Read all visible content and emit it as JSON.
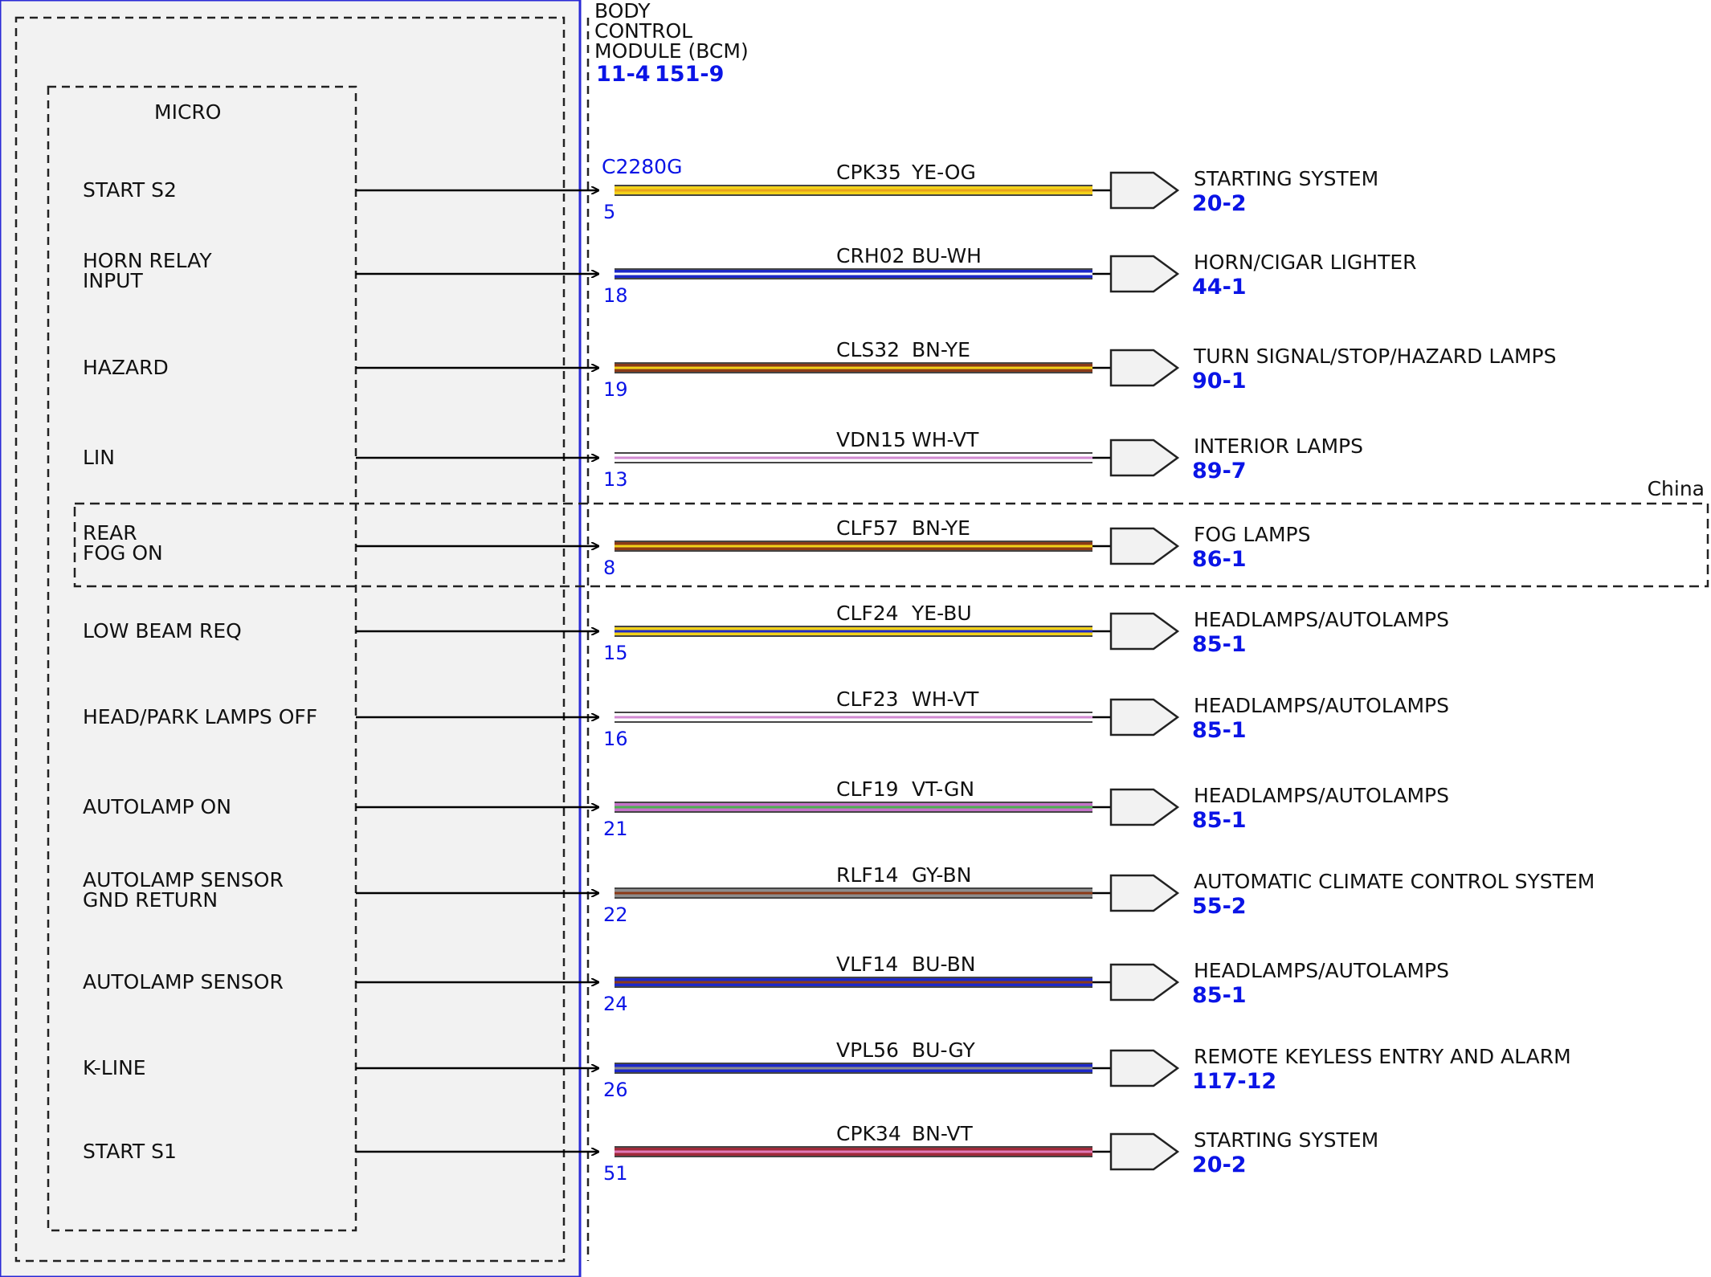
{
  "module": {
    "title_lines": [
      "BODY",
      "CONTROL",
      "MODULE (BCM)"
    ],
    "refs": [
      "11-4",
      "151-9"
    ],
    "micro_label": "MICRO",
    "connector": "C2280G"
  },
  "region": {
    "label": "China"
  },
  "circuits": [
    {
      "input": [
        "START S2"
      ],
      "pin": "5",
      "circuit": "CPK35",
      "color": "YE-OG",
      "stripe": [
        "#f2d21a",
        "#e8a11c"
      ],
      "dest": "STARTING SYSTEM",
      "dest_ref": "20-2"
    },
    {
      "input": [
        "HORN RELAY",
        "INPUT"
      ],
      "pin": "18",
      "circuit": "CRH02",
      "color": "BU-WH",
      "stripe": [
        "#1d28c8",
        "#ffffff"
      ],
      "dest": "HORN/CIGAR LIGHTER",
      "dest_ref": "44-1"
    },
    {
      "input": [
        "HAZARD"
      ],
      "pin": "19",
      "circuit": "CLS32",
      "color": "BN-YE",
      "stripe": [
        "#8b3a17",
        "#f2d21a"
      ],
      "dest": "TURN SIGNAL/STOP/HAZARD LAMPS",
      "dest_ref": "90-1"
    },
    {
      "input": [
        "LIN"
      ],
      "pin": "13",
      "circuit": "VDN15",
      "color": "WH-VT",
      "stripe": [
        "#ffffff",
        "#d18ad1"
      ],
      "dest": "INTERIOR LAMPS",
      "dest_ref": "89-7"
    },
    {
      "input": [
        "REAR",
        "FOG ON"
      ],
      "pin": "8",
      "circuit": "CLF57",
      "color": "BN-YE",
      "stripe": [
        "#8b3a17",
        "#f2d21a"
      ],
      "dest": "FOG LAMPS",
      "dest_ref": "86-1"
    },
    {
      "input": [
        "LOW BEAM REQ"
      ],
      "pin": "15",
      "circuit": "CLF24",
      "color": "YE-BU",
      "stripe": [
        "#f2d21a",
        "#1d28c8"
      ],
      "dest": "HEADLAMPS/AUTOLAMPS",
      "dest_ref": "85-1"
    },
    {
      "input": [
        "HEAD/PARK LAMPS OFF"
      ],
      "pin": "16",
      "circuit": "CLF23",
      "color": "WH-VT",
      "stripe": [
        "#ffffff",
        "#d18ad1"
      ],
      "dest": "HEADLAMPS/AUTOLAMPS",
      "dest_ref": "85-1"
    },
    {
      "input": [
        "AUTOLAMP ON"
      ],
      "pin": "21",
      "circuit": "CLF19",
      "color": "VT-GN",
      "stripe": [
        "#c473c9",
        "#4caf50"
      ],
      "dest": "HEADLAMPS/AUTOLAMPS",
      "dest_ref": "85-1"
    },
    {
      "input": [
        "AUTOLAMP SENSOR",
        "GND RETURN"
      ],
      "pin": "22",
      "circuit": "RLF14",
      "color": "GY-BN",
      "stripe": [
        "#8c8c8c",
        "#8b3a17"
      ],
      "dest": "AUTOMATIC CLIMATE CONTROL SYSTEM",
      "dest_ref": "55-2"
    },
    {
      "input": [
        "AUTOLAMP SENSOR"
      ],
      "pin": "24",
      "circuit": "VLF14",
      "color": "BU-BN",
      "stripe": [
        "#1d28c8",
        "#8b3a17"
      ],
      "dest": "HEADLAMPS/AUTOLAMPS",
      "dest_ref": "85-1"
    },
    {
      "input": [
        "K-LINE"
      ],
      "pin": "26",
      "circuit": "VPL56",
      "color": "BU-GY",
      "stripe": [
        "#1d28c8",
        "#8c8c8c"
      ],
      "dest": "REMOTE KEYLESS ENTRY AND ALARM",
      "dest_ref": "117-12"
    },
    {
      "input": [
        "START S1"
      ],
      "pin": "51",
      "circuit": "CPK34",
      "color": "BN-VT",
      "stripe": [
        "#a02a3a",
        "#e07ab8"
      ],
      "dest": "STARTING SYSTEM",
      "dest_ref": "20-2"
    }
  ]
}
